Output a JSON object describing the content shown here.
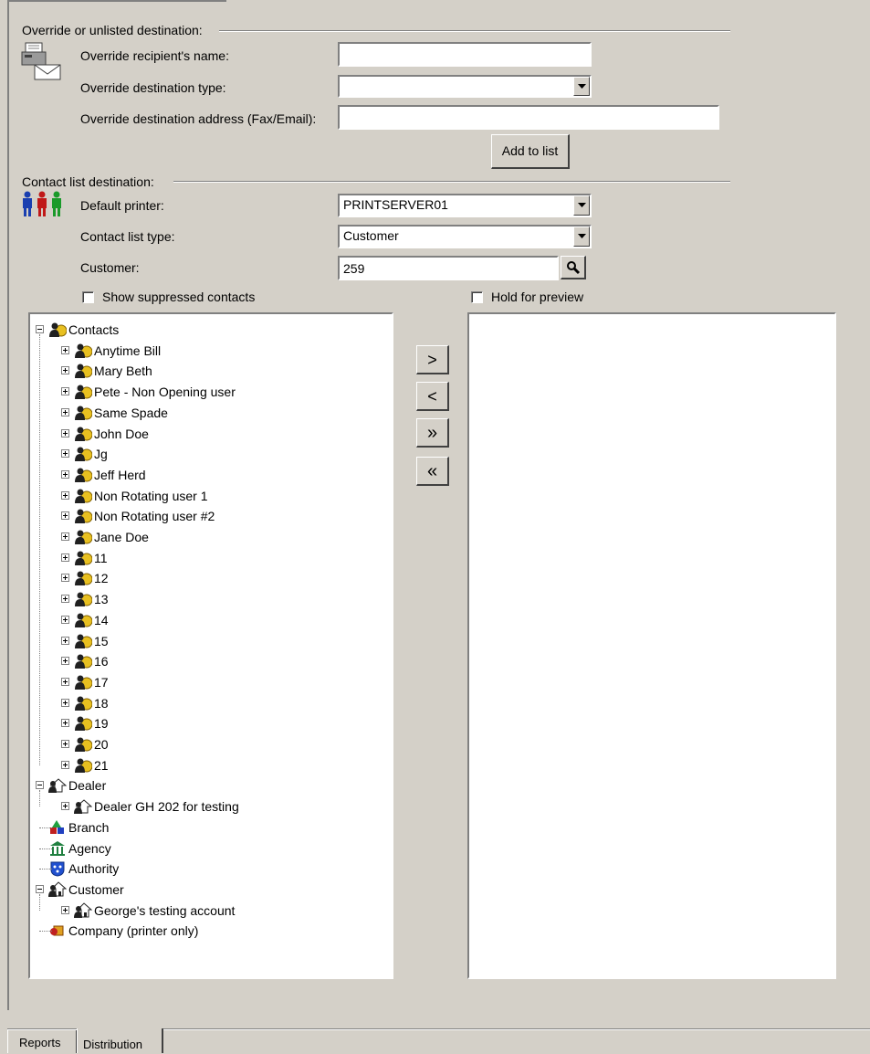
{
  "override": {
    "group_title": "Override or unlisted destination:",
    "recipient_label": "Override recipient's name:",
    "recipient_value": "",
    "dest_type_label": "Override destination type:",
    "dest_type_value": "",
    "address_label": "Override destination address (Fax/Email):",
    "address_value": "",
    "add_button": "Add to list"
  },
  "contact_list": {
    "group_title": "Contact list destination:",
    "printer_label": "Default printer:",
    "printer_value": "PRINTSERVER01",
    "type_label": "Contact list type:",
    "type_value": "Customer",
    "customer_label": "Customer:",
    "customer_value": "259",
    "show_suppressed_label": "Show suppressed contacts",
    "hold_preview_label": "Hold for preview"
  },
  "move_buttons": {
    "add_one": ">",
    "remove_one": "<",
    "add_all": "»",
    "remove_all": "«"
  },
  "tree": {
    "contacts_label": "Contacts",
    "contacts": [
      "Anytime Bill",
      "Mary Beth",
      "Pete - Non Opening user",
      "Same Spade",
      "John Doe",
      "Jg",
      "Jeff Herd",
      "Non Rotating user 1",
      "Non Rotating user #2",
      "Jane Doe",
      "11",
      "12",
      "13",
      "14",
      "15",
      "16",
      "17",
      "18",
      "19",
      "20",
      "21"
    ],
    "dealer_label": "Dealer",
    "dealers": [
      "Dealer GH 202 for testing"
    ],
    "branch_label": "Branch",
    "agency_label": "Agency",
    "authority_label": "Authority",
    "customer_label": "Customer",
    "customers": [
      "George's testing account"
    ],
    "company_label": "Company (printer only)"
  },
  "tabs": {
    "reports": "Reports",
    "distribution": "Distribution"
  }
}
